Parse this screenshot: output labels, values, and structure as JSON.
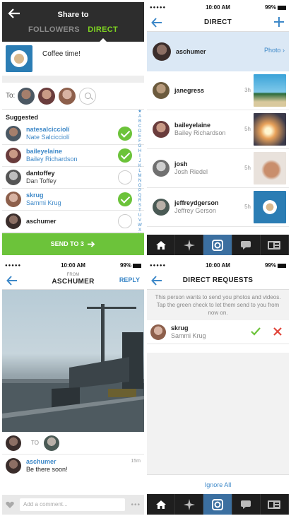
{
  "colors": {
    "accent_green": "#6cc33a",
    "link_blue": "#3d88c8",
    "header_dark": "#2d2d2d"
  },
  "share": {
    "title": "Share to",
    "tabs": [
      "FOLLOWERS",
      "DIRECT"
    ],
    "active_tab": "DIRECT",
    "caption": "Coffee time!",
    "to_label": "To:",
    "suggested_label": "Suggested",
    "alphabet": "★ABCDEFGHIJKLMNOPQRSTUVWXYZ",
    "users": [
      {
        "username": "natesalcicciolí",
        "fullname": "Nate Salcicciolí",
        "selected": true
      },
      {
        "username": "baileyelaine",
        "fullname": "Bailey Richardson",
        "selected": true
      },
      {
        "username": "dantoffey",
        "fullname": "Dan Toffey",
        "selected": false
      },
      {
        "username": "skrug",
        "fullname": "Sammi Krug",
        "selected": true
      },
      {
        "username": "aschumer",
        "fullname": "",
        "selected": false
      }
    ],
    "send_label": "SEND TO 3"
  },
  "direct": {
    "status_time": "10:00 AM",
    "battery": "99%",
    "title": "DIRECT",
    "first": {
      "username": "aschumer",
      "action": "Photo"
    },
    "threads": [
      {
        "username": "janegress",
        "fullname": "",
        "time": "3h"
      },
      {
        "username": "baileyelaine",
        "fullname": "Bailey Richardson",
        "time": "5h"
      },
      {
        "username": "josh",
        "fullname": "Josh Riedel",
        "time": "5h"
      },
      {
        "username": "jeffreydgerson",
        "fullname": "Jeffrey Gerson",
        "time": "5h"
      }
    ],
    "tabs": [
      "home-icon",
      "explore-icon",
      "camera-icon",
      "activity-icon",
      "profile-icon"
    ]
  },
  "message": {
    "status_time": "10:00 AM",
    "battery": "99%",
    "from_label": "FROM",
    "from_user": "ASCHUMER",
    "reply_label": "REPLY",
    "to_label": "TO",
    "comment": {
      "username": "aschumer",
      "text": "Be there soon!",
      "time": "15m"
    },
    "comment_placeholder": "Add a comment...",
    "more": "•••"
  },
  "requests": {
    "status_time": "10:00 AM",
    "battery": "99%",
    "title": "DIRECT REQUESTS",
    "description": "This person wants to send you photos and videos. Tap the green check to let them send to you from now on.",
    "user": {
      "username": "skrug",
      "fullname": "Sammi Krug"
    },
    "ignore_label": "Ignore All"
  }
}
